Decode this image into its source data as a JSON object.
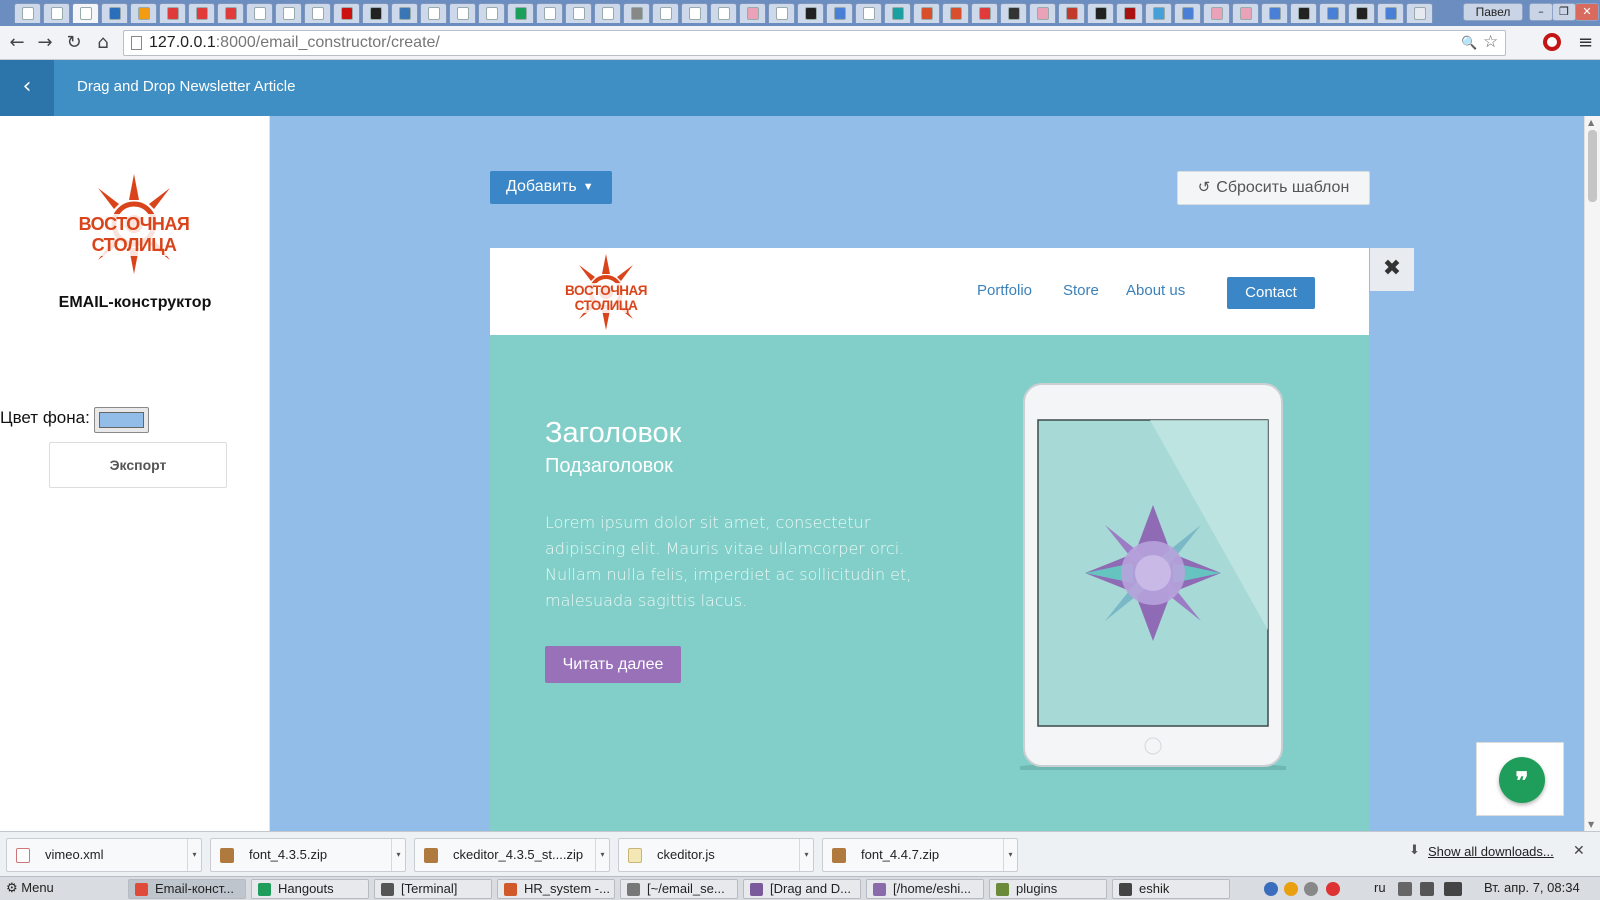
{
  "browser": {
    "tab_colors": [
      "#ffffff",
      "#ffffff",
      "#ffffff",
      "#2a6ebc",
      "#f39c12",
      "#e03a3a",
      "#e03a3a",
      "#e03a3a",
      "#ffffff",
      "#ffffff",
      "#ffffff",
      "#cc1111",
      "#222222",
      "#3a76b5",
      "#ffffff",
      "#ffffff",
      "#ffffff",
      "#19a05a",
      "#ffffff",
      "#ffffff",
      "#ffffff",
      "#888888",
      "#ffffff",
      "#ffffff",
      "#ffffff",
      "#e9a2b8",
      "#ffffff",
      "#222222",
      "#4a7fd8",
      "#ffffff",
      "#1aa0a0",
      "#d94f2b",
      "#d94f2b",
      "#e03a3a",
      "#333333",
      "#e9a2b8",
      "#c0392b",
      "#222222",
      "#aa1111",
      "#46a0d8",
      "#4a7fd8",
      "#e9a2b8",
      "#e9a2b8",
      "#4a7fd8",
      "#222222",
      "#4a7fd8",
      "#222222",
      "#4a7fd8",
      "#e6e9ef"
    ],
    "user_name": "Павел",
    "window_min": "–",
    "window_max": "❐",
    "window_close": "✕",
    "url_host": "127.0.0.1",
    "url_path": ":8000/email_constructor/create/",
    "back_icon": "←",
    "forward_icon": "→",
    "reload_icon": "↻",
    "home_icon": "⌂",
    "zoom_icon": "🔍",
    "star_icon": "☆",
    "menu_icon": "≡"
  },
  "header": {
    "back_icon": "‹",
    "title": "Drag and Drop Newsletter Article"
  },
  "left": {
    "logo_word": "ВОСТОЧНАЯ СТОЛИЦА",
    "constructor_title": "EMAIL-конструктор",
    "bg_label": "Цвет фона:",
    "bg_color": "#92bde8",
    "export_label": "Экспорт"
  },
  "canvas": {
    "bg_color": "#92bde8",
    "add_label": "Добавить",
    "add_caret": "▼",
    "reset_icon": "↺",
    "reset_label": "Сбросить шаблон",
    "close_icon": "✖",
    "email": {
      "logo_word": "ВОСТОЧНАЯ СТОЛИЦА",
      "nav": [
        "Portfolio",
        "Store",
        "About us"
      ],
      "contact_label": "Contact",
      "hero_bg": "#82cfc9",
      "hero_title": "Заголовок",
      "hero_subtitle": "Подзаголовок",
      "hero_text": "Lorem ipsum dolor sit amet, consectetur adipiscing elit. Mauris vitae ullamcorper orci. Nullam nulla felis, imperdiet ac sollicitudin et, malesuada sagittis lacus.",
      "read_more_label": "Читать далее"
    },
    "quote_icon": "❞"
  },
  "downloads": {
    "items": [
      {
        "name": "vimeo.xml",
        "type": "xml"
      },
      {
        "name": "font_4.3.5.zip",
        "type": "zip"
      },
      {
        "name": "ckeditor_4.3.5_st....zip",
        "type": "zip"
      },
      {
        "name": "ckeditor.js",
        "type": "js"
      },
      {
        "name": "font_4.4.7.zip",
        "type": "zip"
      }
    ],
    "drop_icon": "▾",
    "show_all_icon": "⬇",
    "show_all_label": "Show all downloads...",
    "close_icon": "✕"
  },
  "taskbar": {
    "menu_label": "⚙ Menu",
    "apps": [
      {
        "label": "Email-конст...",
        "active": true,
        "color": "#e04a3a"
      },
      {
        "label": "Hangouts",
        "active": false,
        "color": "#1e9e5a"
      },
      {
        "label": "[Terminal]",
        "active": false,
        "color": "#555555"
      },
      {
        "label": "HR_system -...",
        "active": false,
        "color": "#d05a2a"
      },
      {
        "label": "[~/email_se...",
        "active": false,
        "color": "#777777"
      },
      {
        "label": "[Drag and D...",
        "active": false,
        "color": "#7a5a9a"
      },
      {
        "label": "[/home/eshi...",
        "active": false,
        "color": "#8a6aaa"
      },
      {
        "label": "plugins",
        "active": false,
        "color": "#6b8a3a"
      },
      {
        "label": "eshik",
        "active": false,
        "color": "#444444"
      }
    ],
    "lang": "ru",
    "clock": "Вт. апр.  7, 08:34"
  }
}
